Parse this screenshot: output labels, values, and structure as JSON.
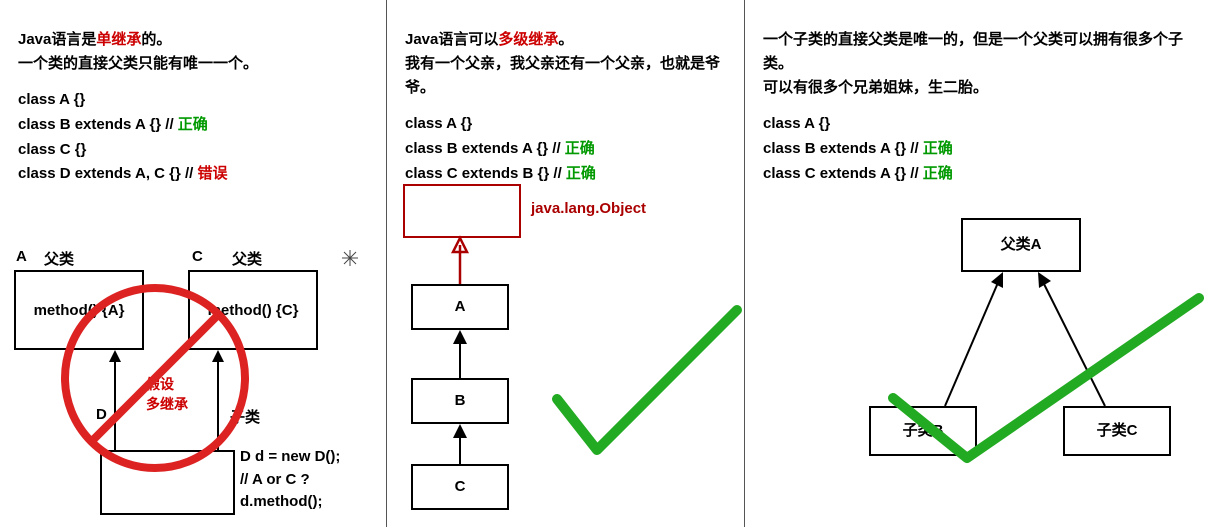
{
  "col1": {
    "line1_a": "Java语言是",
    "line1_b": "单继承",
    "line1_c": "的。",
    "line2": "一个类的直接父类只能有唯一一个。",
    "code1": "class A {}",
    "code2a": "class B extends A {} // ",
    "code2b": "正确",
    "code3": "class C {}",
    "code4a": "class D extends A, C {} // ",
    "code4b": "错误",
    "labelA": "A",
    "labelA_parent": "父类",
    "labelC": "C",
    "labelC_parent": "父类",
    "boxA_method": "method() {A}",
    "boxC_method": "method() {C}",
    "labelD": "D",
    "label_sub": "子类",
    "assume": "假设",
    "multi": "多继承",
    "cb1": "D d = new D();",
    "cb2": "// A or C ?",
    "cb3": "d.method();"
  },
  "col2": {
    "line1_a": "Java语言可以",
    "line1_b": "多级继承",
    "line1_c": "。",
    "line2": "我有一个父亲，我父亲还有一个父亲，也就是爷爷。",
    "code1": "class A {}",
    "code2a": "class B extends A {} // ",
    "code2b": "正确",
    "code3a": "class C extends B {} // ",
    "code3b": "正确",
    "objLabel": "java.lang.Object",
    "boxA": "A",
    "boxB": "B",
    "boxC": "C"
  },
  "col3": {
    "line1": "一个子类的直接父类是唯一的，但是一个父类可以拥有很多个子类。",
    "line2": "可以有很多个兄弟姐妹，生二胎。",
    "code1": "class A {}",
    "code2a": "class B extends A {} // ",
    "code2b": "正确",
    "code3a": "class C extends A {} // ",
    "code3b": "正确",
    "parentBox": "父类A",
    "childB": "子类B",
    "childC": "子类C"
  }
}
